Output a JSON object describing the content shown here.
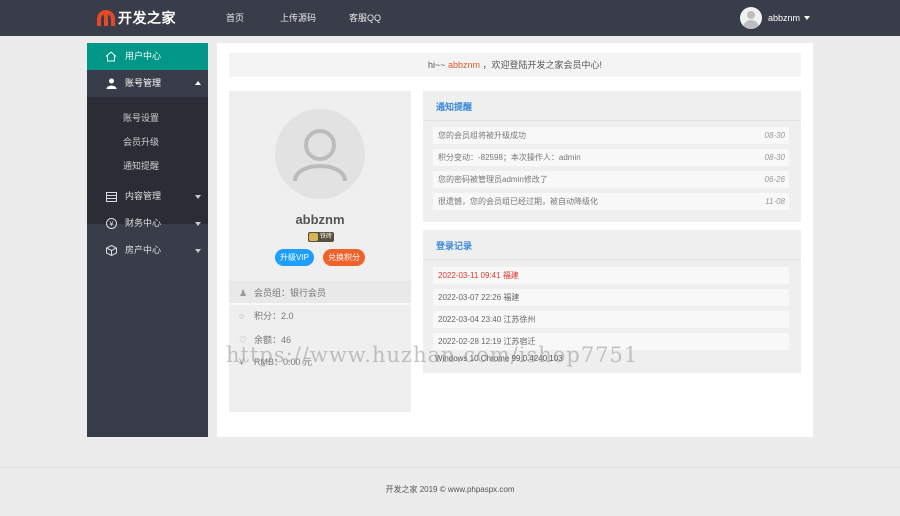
{
  "header": {
    "logo_text": "开发之家",
    "nav": [
      "首页",
      "上传源码",
      "客服QQ"
    ],
    "user_name": "abbznm"
  },
  "sidebar": {
    "items": [
      {
        "label": "用户中心",
        "icon": "home-icon"
      },
      {
        "label": "账号管理",
        "icon": "user-icon"
      },
      {
        "label": "内容管理",
        "icon": "content-icon"
      },
      {
        "label": "财务中心",
        "icon": "finance-icon"
      },
      {
        "label": "房产中心",
        "icon": "box-icon"
      }
    ],
    "sub_items": [
      "账号设置",
      "会员升级",
      "通知提醒"
    ]
  },
  "welcome": {
    "prefix": "hi~~ ",
    "user": "abbznm",
    "suffix": " ，欢迎登陆开发之家会员中心!"
  },
  "profile": {
    "name": "abbznm",
    "badge": "铁砖",
    "btn_vip": "升级VIP",
    "btn_points": "兑换积分",
    "info": [
      {
        "icon": "user-icon",
        "text": "会员组：银行会员"
      },
      {
        "icon": "circle-icon",
        "text": "积分：2.0"
      },
      {
        "icon": "heart-icon",
        "text": "余额：46"
      },
      {
        "icon": "rmb-icon",
        "text": "RMB：0.00 元"
      }
    ]
  },
  "notice": {
    "title": "通知提醒",
    "items": [
      {
        "text": "您的会员组将被升级成功",
        "date": "08-30"
      },
      {
        "text": "积分变动：-82598；本次操作人：admin",
        "date": "08-30"
      },
      {
        "text": "您的密码被管理员admin修改了",
        "date": "06-26"
      },
      {
        "text": "很遗憾，您的会员组已经过期，被自动降级化",
        "date": "11-08"
      }
    ]
  },
  "login": {
    "title": "登录记录",
    "items": [
      {
        "time": "2022-03-11 09:41",
        "place": "福建"
      },
      {
        "time": "2022-03-07 22:26",
        "place": "福建"
      },
      {
        "time": "2022-03-04 23:40",
        "place": "江苏徐州"
      },
      {
        "time": "2022-02-28 12:19",
        "place": "江苏宿迁"
      }
    ],
    "extra": "Windows 10 Chrome 99.0.4240.103"
  },
  "watermark": "https://www.huzhan.com/ishop7751",
  "footer": "开发之家 2019 © www.phpaspx.com",
  "colors": {
    "topbar": "#393d49",
    "active": "#009688",
    "vip": "#1e9fff",
    "points": "#f1612a",
    "accent": "#e0592a"
  }
}
